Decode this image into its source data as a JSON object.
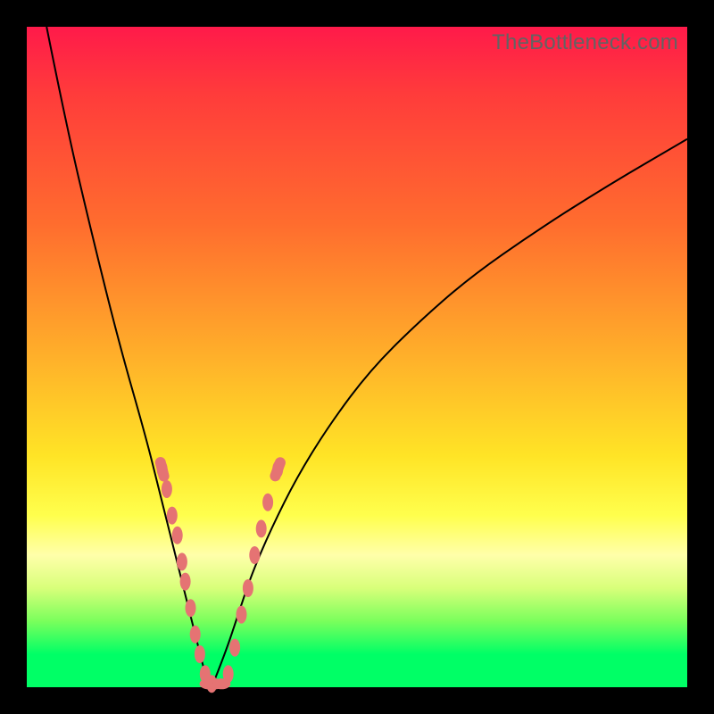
{
  "watermark": "TheBottleneck.com",
  "colors": {
    "background_frame": "#000000",
    "gradient_top": "#ff1a4a",
    "gradient_mid1": "#ff6d2e",
    "gradient_mid2": "#ffe426",
    "gradient_bottom": "#00ff66",
    "curve": "#000000",
    "bead": "#e57373"
  },
  "chart_data": {
    "type": "line",
    "title": "",
    "xlabel": "",
    "ylabel": "",
    "xlim": [
      0,
      100
    ],
    "ylim": [
      0,
      100
    ],
    "grid": false,
    "legend": false,
    "note": "Two V-shaped bottleneck curves meeting near x≈28 at y≈0 on a red→green vertical gradient. Dotted bead segments near the trough. Values estimated from pixel positions (0–100 each axis; y measured from bottom).",
    "series": [
      {
        "name": "left-curve",
        "x": [
          3,
          6,
          10,
          14,
          18,
          20,
          22,
          24,
          25,
          26,
          27,
          28
        ],
        "y": [
          100,
          85,
          68,
          52,
          38,
          30,
          22,
          14,
          10,
          6,
          2,
          0
        ]
      },
      {
        "name": "right-curve",
        "x": [
          28,
          30,
          32,
          34,
          37,
          41,
          46,
          52,
          59,
          67,
          77,
          88,
          100
        ],
        "y": [
          0,
          5,
          11,
          17,
          24,
          32,
          40,
          48,
          55,
          62,
          69,
          76,
          83
        ]
      }
    ],
    "beads_left": [
      {
        "x": 20.5,
        "y": 33
      },
      {
        "x": 21.2,
        "y": 30
      },
      {
        "x": 22.0,
        "y": 26
      },
      {
        "x": 22.8,
        "y": 23
      },
      {
        "x": 23.5,
        "y": 19
      },
      {
        "x": 24.0,
        "y": 16
      },
      {
        "x": 24.8,
        "y": 12
      },
      {
        "x": 25.5,
        "y": 8
      },
      {
        "x": 26.2,
        "y": 5
      },
      {
        "x": 27.0,
        "y": 2
      },
      {
        "x": 28.0,
        "y": 0.5
      }
    ],
    "beads_right": [
      {
        "x": 30.5,
        "y": 2
      },
      {
        "x": 31.5,
        "y": 6
      },
      {
        "x": 32.5,
        "y": 11
      },
      {
        "x": 33.5,
        "y": 15
      },
      {
        "x": 34.5,
        "y": 20
      },
      {
        "x": 35.5,
        "y": 24
      },
      {
        "x": 36.5,
        "y": 28
      },
      {
        "x": 38.0,
        "y": 33
      }
    ],
    "beads_bottom": [
      {
        "x": 27.5,
        "y": 0.5
      },
      {
        "x": 28.5,
        "y": 0.5
      },
      {
        "x": 29.5,
        "y": 0.5
      }
    ]
  }
}
